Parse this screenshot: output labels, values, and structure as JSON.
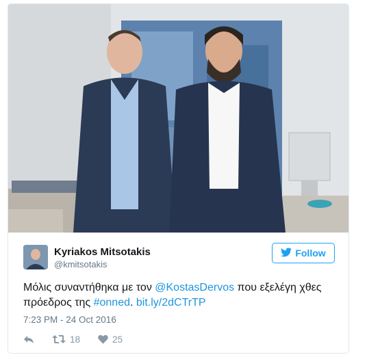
{
  "tweet": {
    "author_name": "Kyriakos Mitsotakis",
    "author_handle": "@kmitsotakis",
    "follow_label": "Follow",
    "text_before": "Μόλις συναντήθηκα με τον ",
    "mention": "@KostasDervos",
    "text_middle": " που εξελέγη χθες πρόεδρος της ",
    "hashtag": "#onned",
    "text_after": ". ",
    "link": "bit.ly/2dCTrTP",
    "timestamp": "7:23 PM - 24 Oct 2016",
    "retweet_count": "18",
    "like_count": "25"
  },
  "icons": {
    "reply": "reply-icon",
    "retweet": "retweet-icon",
    "like": "heart-icon",
    "follow": "twitter-bird-icon"
  },
  "colors": {
    "accent": "#1da1f2",
    "link": "#1b95e0",
    "muted": "#657786"
  }
}
